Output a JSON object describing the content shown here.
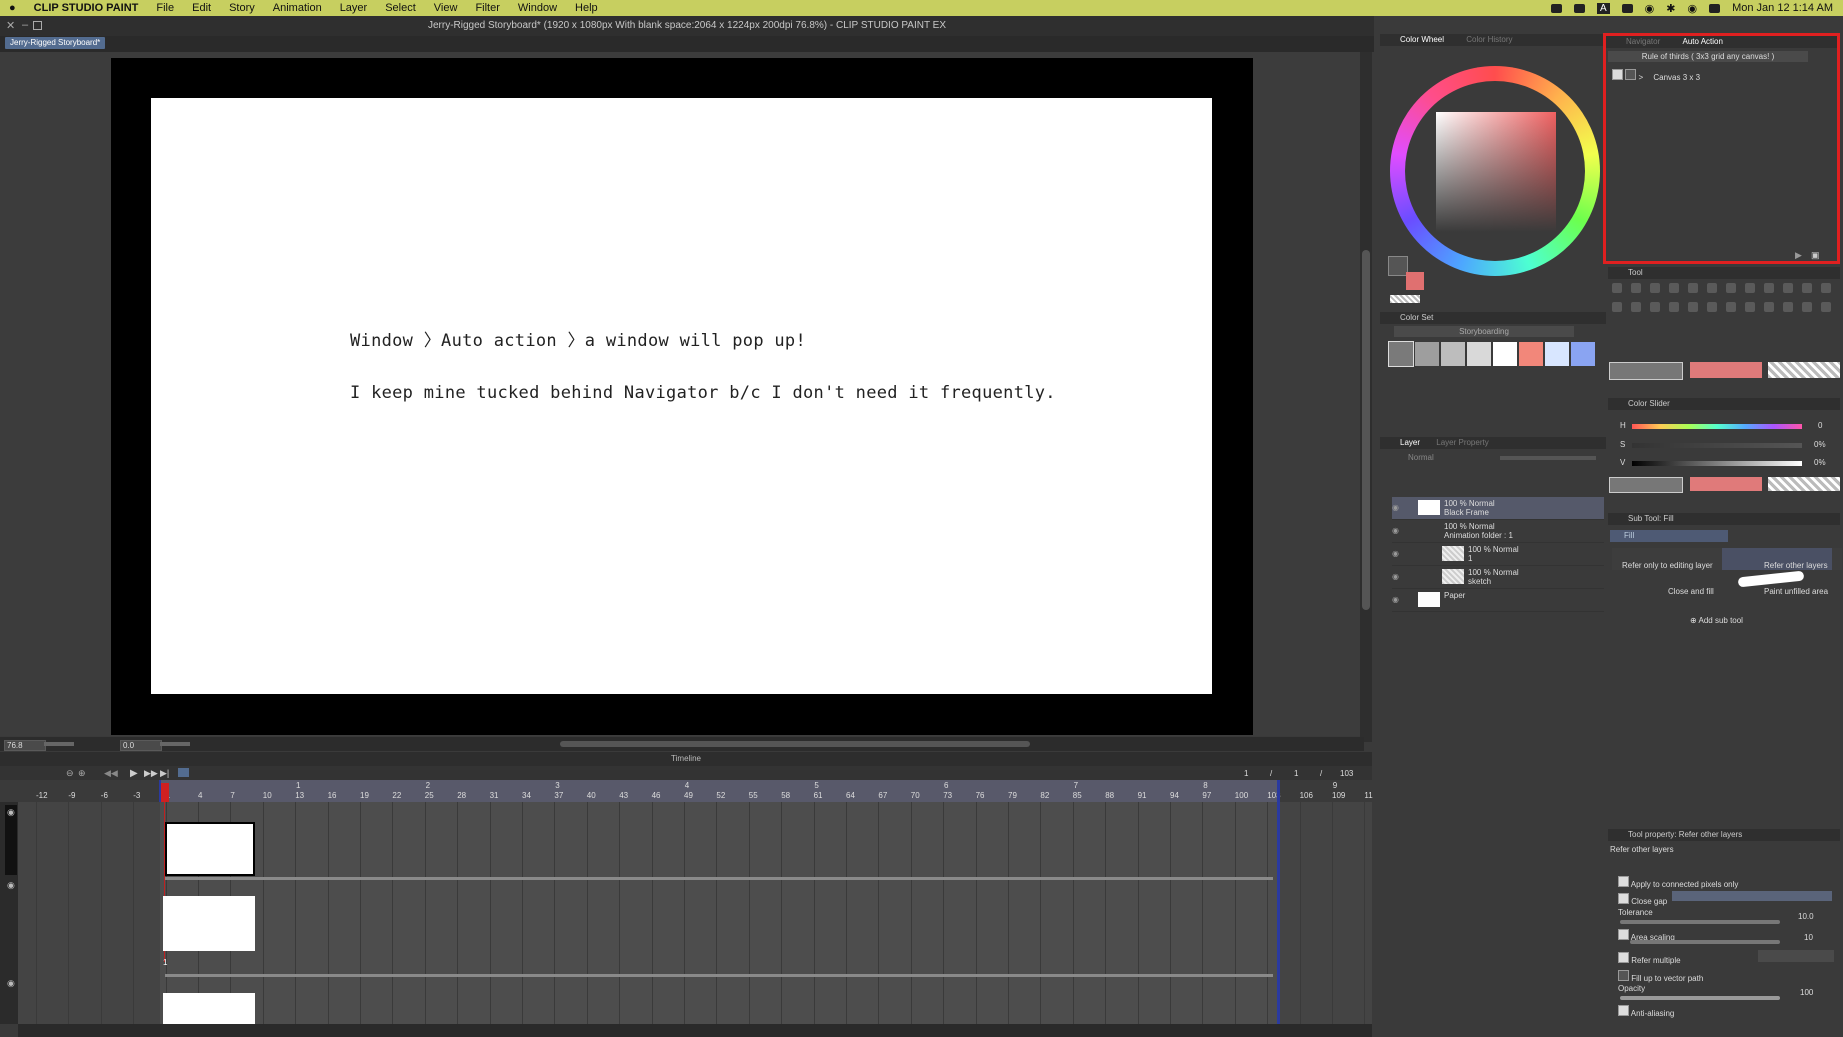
{
  "menubar": {
    "app": "CLIP STUDIO PAINT",
    "items": [
      "File",
      "Edit",
      "Story",
      "Animation",
      "Layer",
      "Select",
      "View",
      "Filter",
      "Window",
      "Help"
    ],
    "datetime": "Mon Jan 12  1:14 AM",
    "status_letter": "A"
  },
  "window": {
    "title": "Jerry-Rigged Storyboard* (1920 x 1080px With blank space:2064 x 1224px 200dpi 76.8%)  - CLIP STUDIO PAINT EX",
    "tab": "Jerry-Rigged Storyboard*"
  },
  "canvas": {
    "line1": "Window 〉Auto action 〉a window will pop up!",
    "line2": "I keep mine tucked behind Navigator b/c I don't need it frequently."
  },
  "status": {
    "zoom": "76.8",
    "rotation": "0.0"
  },
  "timeline": {
    "title": "Timeline",
    "frame_current": "1",
    "frame_sep": "/",
    "frame_a": "1",
    "frame_b": "1",
    "frame_total": "103",
    "ruler_small": [
      "-12",
      "-9",
      "-6",
      "-3",
      "1",
      "4",
      "7",
      "10",
      "13",
      "16",
      "19",
      "22",
      "25",
      "28",
      "31",
      "34",
      "37",
      "40",
      "43",
      "46",
      "49",
      "52",
      "55",
      "58",
      "61",
      "64",
      "67",
      "70",
      "73",
      "76",
      "79",
      "82",
      "85",
      "88",
      "91",
      "94",
      "97",
      "100",
      "103",
      "106",
      "109",
      "11"
    ],
    "ruler_big": [
      "1",
      "2",
      "3",
      "4",
      "5",
      "6",
      "7",
      "8",
      "9"
    ],
    "track_marker": "1"
  },
  "panels": {
    "color_wheel_tab": "Color Wheel",
    "color_history_tab": "Color History",
    "navigator_tab": "Navigator",
    "auto_action_tab": "Auto Action",
    "auto_action_set": "Rule of thirds ( 3x3 grid any canvas! )",
    "auto_action_item": "Canvas 3 x 3",
    "tool_title": "Tool",
    "color_set_title": "Color Set",
    "color_set_name": "Storyboarding",
    "color_swatches": [
      "#7a7a7a",
      "#9e9e9e",
      "#bdbdbd",
      "#d9d9d9",
      "#ffffff",
      "#f2877a",
      "#d8e6ff",
      "#8aa4f2"
    ],
    "color_slider_title": "Color Slider",
    "hsv": [
      {
        "k": "H",
        "v": "0"
      },
      {
        "k": "S",
        "v": "0%"
      },
      {
        "k": "V",
        "v": "0%"
      }
    ],
    "layer_tab": "Layer",
    "layer_property_tab": "Layer Property",
    "layer_blend": "Normal",
    "layers": [
      {
        "name": "100 % Normal",
        "sub": "Black Frame"
      },
      {
        "name": "100 % Normal",
        "sub": "Animation folder : 1"
      },
      {
        "name": "100 % Normal",
        "sub": "1"
      },
      {
        "name": "100 % Normal",
        "sub": "sketch"
      },
      {
        "name": "",
        "sub": "Paper"
      }
    ],
    "sub_tool_title": "Sub Tool: Fill",
    "sub_tool_fill": "Fill",
    "sub_tools": [
      "Refer only to editing layer",
      "Refer other layers",
      "Close and fill",
      "Paint unfilled area"
    ],
    "add_sub_tool": "Add sub tool",
    "tool_property_title": "Tool property: Refer other layers",
    "tool_property_sub": "Refer other layers",
    "props": {
      "apply_connected": "Apply to connected pixels only",
      "close_gap": "Close gap",
      "tolerance": "Tolerance",
      "tolerance_val": "10.0",
      "area_scaling": "Area scaling",
      "area_val": "10",
      "refer_multiple": "Refer multiple",
      "fill_vector": "Fill up to vector path",
      "opacity": "Opacity",
      "opacity_val": "100",
      "anti_aliasing": "Anti-aliasing"
    }
  },
  "colors": {
    "menubar_bg": "#c7cf60",
    "accent_red": "#e02020",
    "tab_blue": "#536c90",
    "playhead_red": "#d02020",
    "end_blue": "#2a3aa0"
  }
}
